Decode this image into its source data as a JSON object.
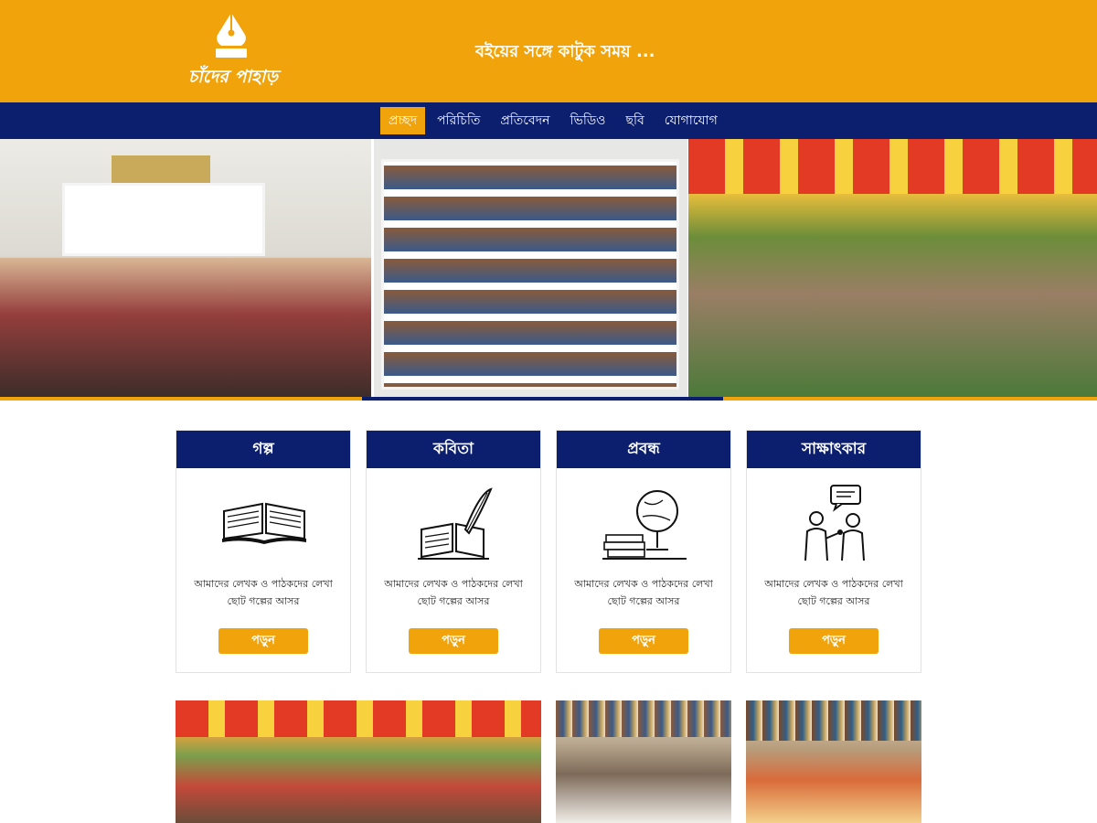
{
  "site": {
    "logo_text": "চাঁদের পাহাড়",
    "tagline": "বইয়ের সঙ্গে কাটুক সময় ..."
  },
  "nav": {
    "items": [
      {
        "label": "প্রচ্ছদ",
        "active": true
      },
      {
        "label": "পরিচিতি",
        "active": false
      },
      {
        "label": "প্রতিবেদন",
        "active": false
      },
      {
        "label": "ভিডিও",
        "active": false
      },
      {
        "label": "ছবি",
        "active": false
      },
      {
        "label": "যোগাযোগ",
        "active": false
      }
    ]
  },
  "colors": {
    "accent": "#f0a30a",
    "navy": "#0c1f6e"
  },
  "cards": [
    {
      "title": "গল্প",
      "icon": "open-book-icon",
      "line1": "আমাদের লেখক ও পাঠকদের লেখা",
      "line2": "ছোট গল্পের আসর",
      "button": "পড়ুন"
    },
    {
      "title": "কবিতা",
      "icon": "quill-book-icon",
      "line1": "আমাদের লেখক ও পাঠকদের লেখা",
      "line2": "ছোট গল্পের আসর",
      "button": "পড়ুন"
    },
    {
      "title": "প্রবন্ধ",
      "icon": "globe-books-icon",
      "line1": "আমাদের লেখক ও পাঠকদের লেখা",
      "line2": "ছোট গল্পের আসর",
      "button": "পড়ুন"
    },
    {
      "title": "সাক্ষাৎকার",
      "icon": "interview-icon",
      "line1": "আমাদের লেখক ও পাঠকদের লেখা",
      "line2": "ছোট গল্পের আসর",
      "button": "পড়ুন"
    }
  ]
}
